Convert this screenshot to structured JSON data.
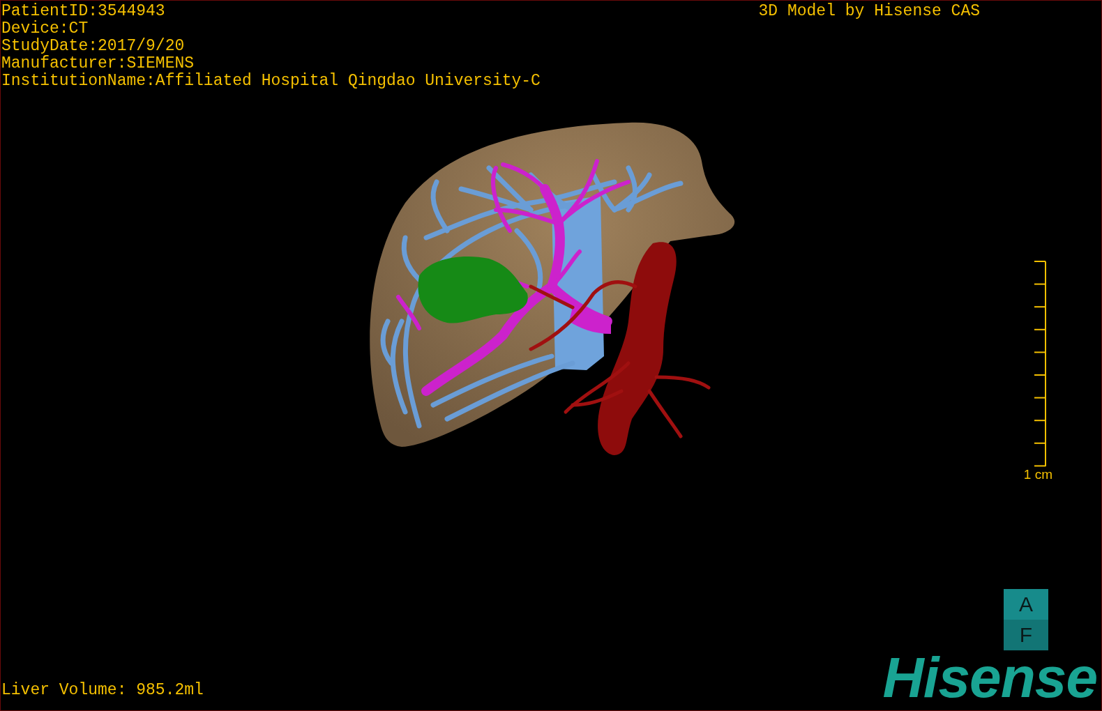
{
  "patient_info": [
    "PatientID:3544943",
    "Device:CT",
    "StudyDate:2017/9/20",
    "Manufacturer:SIEMENS",
    "InstitutionName:Affiliated Hospital Qingdao University-C"
  ],
  "credit": "3D Model by Hisense CAS",
  "scale_bar": {
    "label": "1 cm"
  },
  "measurement": "Liver Volume: 985.2ml",
  "orientation_cube": {
    "top": "A",
    "front": "F"
  },
  "logo": "Hisense"
}
